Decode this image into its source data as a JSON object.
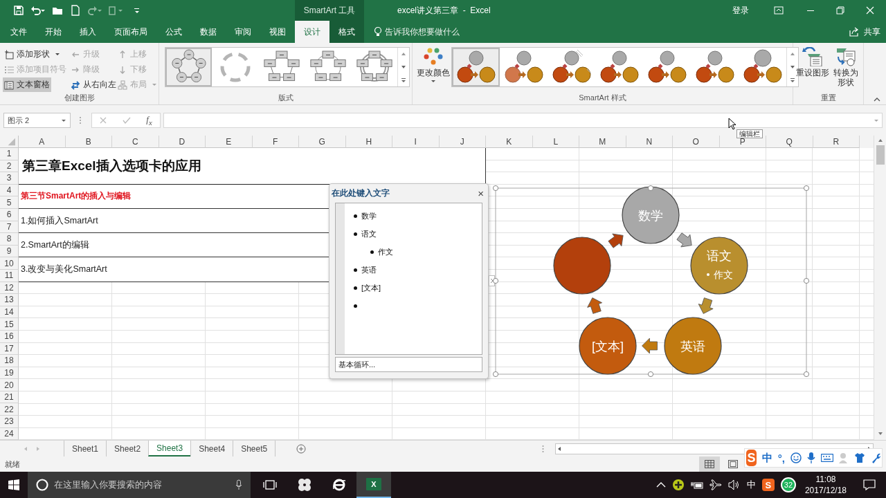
{
  "title_bar": {
    "context_label": "SmartArt 工具",
    "title": "excel讲义第三章  -  Excel",
    "sign_in": "登录"
  },
  "tabs": [
    {
      "label": "文件",
      "selected": false,
      "kind": "normal"
    },
    {
      "label": "开始",
      "selected": false,
      "kind": "normal"
    },
    {
      "label": "插入",
      "selected": false,
      "kind": "normal"
    },
    {
      "label": "页面布局",
      "selected": false,
      "kind": "normal"
    },
    {
      "label": "公式",
      "selected": false,
      "kind": "normal"
    },
    {
      "label": "数据",
      "selected": false,
      "kind": "normal"
    },
    {
      "label": "审阅",
      "selected": false,
      "kind": "normal"
    },
    {
      "label": "视图",
      "selected": false,
      "kind": "normal"
    },
    {
      "label": "设计",
      "selected": true,
      "kind": "context"
    },
    {
      "label": "格式",
      "selected": false,
      "kind": "context"
    }
  ],
  "tell_me": "告诉我你想要做什么",
  "share": "共享",
  "ribbon": {
    "create_graphic": {
      "label": "创建图形",
      "commands": [
        {
          "label": "添加形状",
          "disabled": false,
          "on": false
        },
        {
          "label": "添加项目符号",
          "disabled": true,
          "on": false
        },
        {
          "label": "文本窗格",
          "disabled": false,
          "on": true
        },
        {
          "label": "升级",
          "disabled": true,
          "on": false
        },
        {
          "label": "降级",
          "disabled": true,
          "on": false
        },
        {
          "label": "从右向左",
          "disabled": false,
          "on": false
        },
        {
          "label": "上移",
          "disabled": true,
          "on": false
        },
        {
          "label": "下移",
          "disabled": true,
          "on": false
        },
        {
          "label": "布局",
          "disabled": true,
          "on": false
        }
      ]
    },
    "layouts": {
      "label": "版式",
      "items": [
        {
          "kind": "circles",
          "selected": true
        },
        {
          "kind": "arrows",
          "selected": false
        },
        {
          "kind": "boxes",
          "selected": false
        },
        {
          "kind": "ring_boxes",
          "selected": false
        },
        {
          "kind": "double_boxes",
          "selected": false
        }
      ]
    },
    "styles": {
      "label": "SmartArt 样式",
      "change_colors": "更改颜色",
      "items": [
        {
          "selected": true
        },
        {
          "selected": false
        },
        {
          "selected": false
        },
        {
          "selected": false
        },
        {
          "selected": false
        },
        {
          "selected": false
        },
        {
          "selected": false
        }
      ]
    },
    "reset": {
      "label": "重置",
      "commands": [
        "重设图形",
        "转换为形状"
      ]
    }
  },
  "formula_bar": {
    "name_box": "图示 2",
    "function_symbol": "f$_{x}$",
    "tooltip": "编辑栏"
  },
  "sheet": {
    "columns": [
      "A",
      "B",
      "C",
      "D",
      "E",
      "F",
      "G",
      "H",
      "I",
      "J",
      "K",
      "L",
      "M",
      "N",
      "O",
      "P",
      "Q",
      "R"
    ],
    "rows": [
      "1",
      "2",
      "3",
      "4",
      "5",
      "6",
      "7",
      "8",
      "9",
      "10",
      "11",
      "12",
      "13",
      "14",
      "15",
      "16",
      "17",
      "18",
      "19",
      "20",
      "21",
      "22",
      "23",
      "24"
    ],
    "cells": [
      {
        "kind": "title",
        "text": "第三章Excel插入选项卡的应用"
      },
      {
        "kind": "section",
        "text": "第三节SmartArt的插入与编辑"
      },
      {
        "kind": "item",
        "text": "1.如何插入SmartArt"
      },
      {
        "kind": "item",
        "text": "2.SmartArt的编辑"
      },
      {
        "kind": "item",
        "text": "3.改变与美化SmartArt"
      }
    ]
  },
  "text_pane": {
    "title": "在此处键入文字",
    "close": "×",
    "items": [
      {
        "kind": "bullet",
        "text": "数学"
      },
      {
        "kind": "bullet",
        "text": "语文",
        "children": [
          {
            "kind": "bullet",
            "text": "作文"
          }
        ]
      },
      {
        "kind": "bullet",
        "text": "英语"
      },
      {
        "kind": "bullet",
        "text": "[文本]"
      },
      {
        "kind": "blank"
      }
    ],
    "footer": "基本循环..."
  },
  "smartart": {
    "nodes": [
      {
        "text": "数学",
        "color": "#a8a8a8"
      },
      {
        "text": "语文",
        "children": [
          "作文"
        ],
        "color": "#b98f2e"
      },
      {
        "text": "英语",
        "color": "#c07a10"
      },
      {
        "text": "[文本]",
        "color": "#c35b0e"
      },
      {
        "color": "#b3400c"
      }
    ]
  },
  "sheet_tabs": [
    {
      "label": "Sheet1",
      "selected": false
    },
    {
      "label": "Sheet2",
      "selected": false
    },
    {
      "label": "Sheet3",
      "selected": true
    },
    {
      "label": "Sheet4",
      "selected": false
    },
    {
      "label": "Sheet5",
      "selected": false
    }
  ],
  "status_bar": {
    "text": "就绪"
  },
  "ime_toolbar": {
    "logo": "S",
    "mode": "中",
    "punctuation": "°,"
  },
  "taskbar": {
    "search_placeholder": "在这里输入你要搜索的内容",
    "app_letter": "X",
    "input_method": "中",
    "tray_logo": "S",
    "badge": "32",
    "time": "11:08",
    "date": "2017/12/18"
  }
}
